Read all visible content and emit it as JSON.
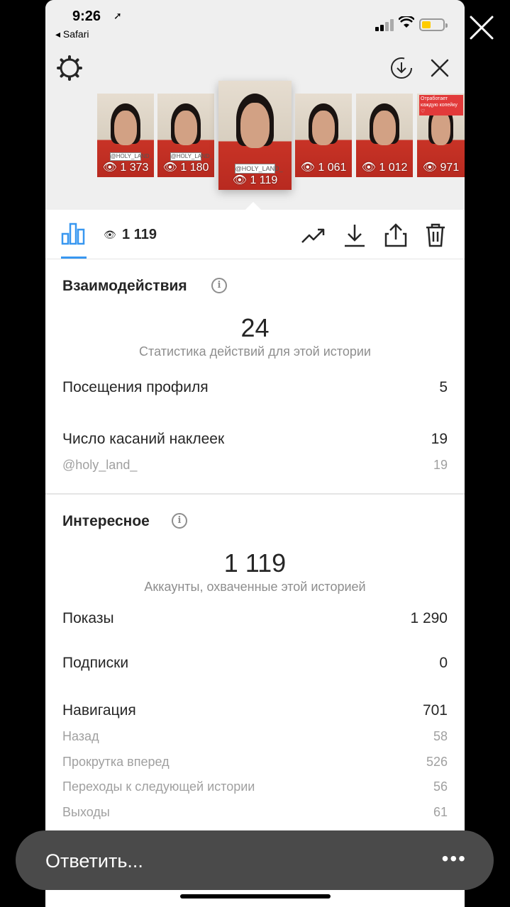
{
  "status": {
    "time": "9:26",
    "back_app": "◂ Safari"
  },
  "thumbnails": [
    {
      "views": "1 373",
      "tag": "@HOLY_LAND_"
    },
    {
      "views": "1 180",
      "tag": "@HOLY_LAND_"
    },
    {
      "views": "1 119",
      "tag": "@HOLY_LAND_",
      "active": true
    },
    {
      "views": "1 061",
      "tag": ""
    },
    {
      "views": "1 012",
      "tag": ""
    },
    {
      "views": "971",
      "note": "Отработает каждую копейку ♡"
    }
  ],
  "toolbar": {
    "views": "1 119"
  },
  "interactions": {
    "title": "Взаимодействия",
    "total": "24",
    "subtitle": "Статистика действий для этой истории",
    "profile_visits_label": "Посещения профиля",
    "profile_visits_value": "5",
    "sticker_taps_label": "Число касаний наклеек",
    "sticker_taps_value": "19",
    "sticker_handle": "@holy_land_",
    "sticker_handle_value": "19"
  },
  "discovery": {
    "title": "Интересное",
    "total": "1 119",
    "subtitle": "Аккаунты, охваченные этой историей",
    "impressions_label": "Показы",
    "impressions_value": "1 290",
    "follows_label": "Подписки",
    "follows_value": "0",
    "navigation_label": "Навигация",
    "navigation_value": "701",
    "nav_items": [
      {
        "label": "Назад",
        "value": "58"
      },
      {
        "label": "Прокрутка вперед",
        "value": "526"
      },
      {
        "label": "Переходы к следующей истории",
        "value": "56"
      },
      {
        "label": "Выходы",
        "value": "61"
      }
    ]
  },
  "reply": {
    "placeholder": "Ответить...",
    "more": "•••"
  }
}
